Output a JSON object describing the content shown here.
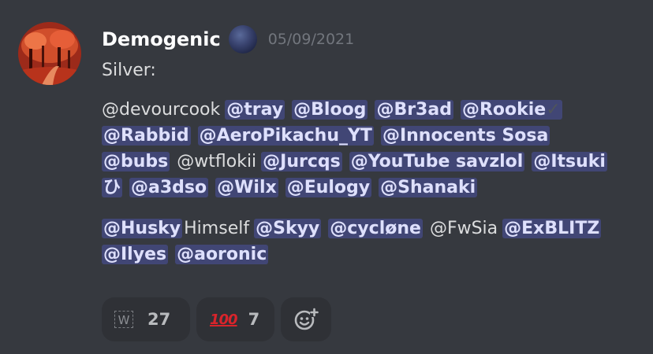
{
  "message": {
    "author": "Demogenic",
    "timestamp": "05/09/2021",
    "lines": [
      "Silver:",
      "@devourcook @tray @Bloog @Br3ad @Rookie✓",
      "@Rabbid @AeroPikachu_YT @Innocents Sosa",
      "@bubs @wtflokii @Jurcqs @YouTube savzlol @Itsuki",
      "ひ @a3dso @Wilx @Eulogy @Shanaki",
      "@HuskyHimself @Skyy @cycløne @FwSia @ExBLITZ",
      "@Ilyes @aoronic"
    ],
    "mentions": {
      "tray": "@tray",
      "bloog": "@Bloog",
      "br3ad": "@Br3ad",
      "rookie": "@Rookie",
      "rabbid": "@Rabbid",
      "aeropikachu": "@AeroPikachu_YT",
      "innocents": "@Innocents Sosa",
      "bubs": "@bubs",
      "jurcqs": "@Jurcqs",
      "savzlol": "@YouTube savzlol",
      "itsuki_1": "@Itsuki",
      "itsuki_2": "ひ",
      "a3dso": "@a3dso",
      "wilx": "@Wilx",
      "eulogy": "@Eulogy",
      "shanaki": "@Shanaki",
      "husky": "@Husky",
      "skyy": "@Skyy",
      "cyclone": "@cycløne",
      "exblitz": "@ExBLITZ",
      "ilyes": "@Ilyes",
      "aoronic": "@aoronic"
    },
    "plain": {
      "silver": "Silver:",
      "devourcook": "@devourcook",
      "check": "✓",
      "wtflokii": "@wtflokii",
      "himself": "Himself",
      "fwsia": "@FwSia"
    }
  },
  "reactions": [
    {
      "icon": "w-keycap-icon",
      "glyph": "W",
      "count": "27"
    },
    {
      "icon": "hundred-points-icon",
      "glyph": "100",
      "count": "7"
    },
    {
      "icon": "add-reaction-icon"
    }
  ],
  "colors": {
    "background": "#36393f",
    "mention_bg": "#414675",
    "mention_text": "#dee0fc",
    "reaction_bg": "#2f3136",
    "timestamp": "#72767d"
  }
}
